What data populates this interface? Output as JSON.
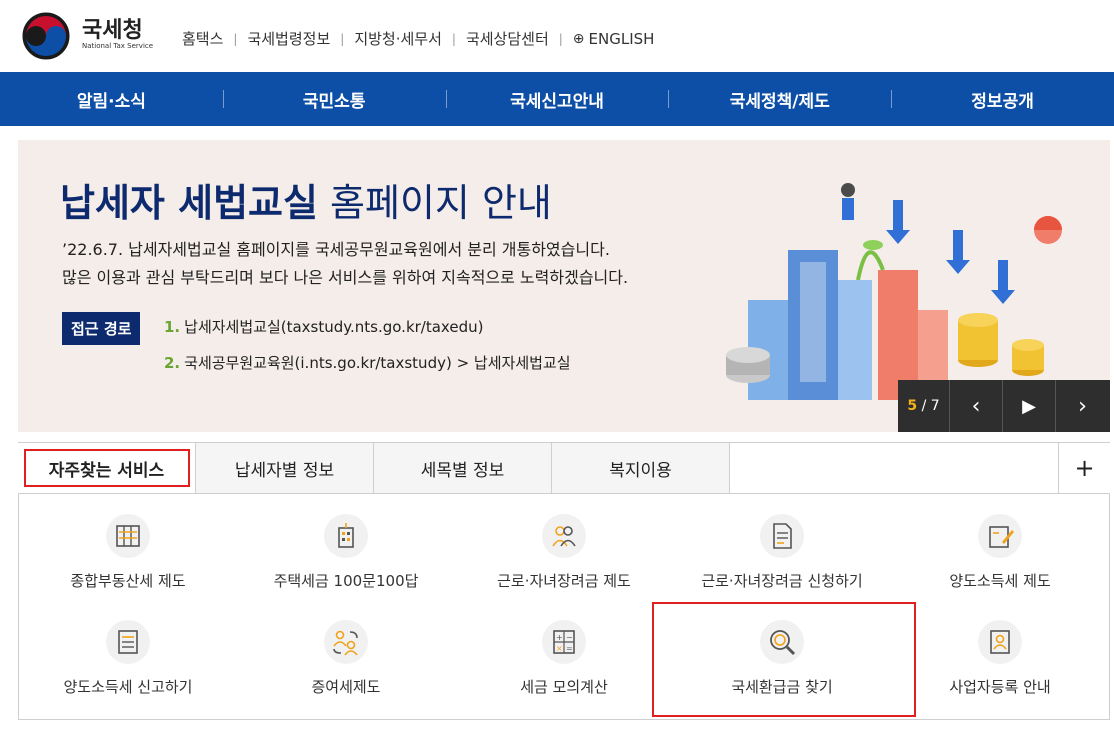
{
  "header": {
    "logo_title": "국세청",
    "logo_sub": "National Tax Service",
    "links": [
      "홈택스",
      "국세법령정보",
      "지방청·세무서",
      "국세상담센터",
      "ENGLISH"
    ],
    "link_separator": "|",
    "globe_glyph": "⊕"
  },
  "nav": [
    "알림·소식",
    "국민소통",
    "국세신고안내",
    "국세정책/제도",
    "정보공개"
  ],
  "banner": {
    "headline_bold": "납세자 세법교실",
    "headline_rest": " 홈페이지 안내",
    "line1": "’22.6.7. 납세자세법교실 홈페이지를 국세공무원교육원에서 분리 개통하였습니다.",
    "line2": "많은 이용과 관심 부탁드리며 보다 나은 서비스를 위하여 지속적으로 노력하겠습니다.",
    "badge": "접근 경로",
    "path1_num": "1.",
    "path1": "납세자세법교실(taxstudy.nts.go.kr/taxedu)",
    "path2_num": "2.",
    "path2": "국세공무원교육원(i.nts.go.kr/taxstudy) > 납세자세법교실",
    "page_current": "5",
    "page_total": "/ 7",
    "prev_glyph": "‹",
    "play_glyph": "▶",
    "next_glyph": "›"
  },
  "tabs": [
    "자주찾는 서비스",
    "납세자별 정보",
    "세목별 정보",
    "복지이용"
  ],
  "tabs_plus": "+",
  "services": [
    {
      "label": "종합부동산세 제도",
      "icon": "ledger-icon"
    },
    {
      "label": "주택세금 100문100답",
      "icon": "building-icon"
    },
    {
      "label": "근로·자녀장려금 제도",
      "icon": "people-icon"
    },
    {
      "label": "근로·자녀장려금 신청하기",
      "icon": "document-icon"
    },
    {
      "label": "양도소득세 제도",
      "icon": "pen-note-icon"
    },
    {
      "label": "양도소득세 신고하기",
      "icon": "list-icon"
    },
    {
      "label": "증여세제도",
      "icon": "exchange-people-icon"
    },
    {
      "label": "세금 모의계산",
      "icon": "calculator-icon"
    },
    {
      "label": "국세환급금 찾기",
      "icon": "magnifier-coin-icon"
    },
    {
      "label": "사업자등록 안내",
      "icon": "id-card-icon"
    }
  ],
  "colors": {
    "nav": "#0d4ea6",
    "highlight": "#e02020",
    "banner_bg": "#f4ede9",
    "title_navy": "#0d2a6e",
    "accent_green": "#6aa532",
    "icon_orange": "#f0a31a"
  }
}
